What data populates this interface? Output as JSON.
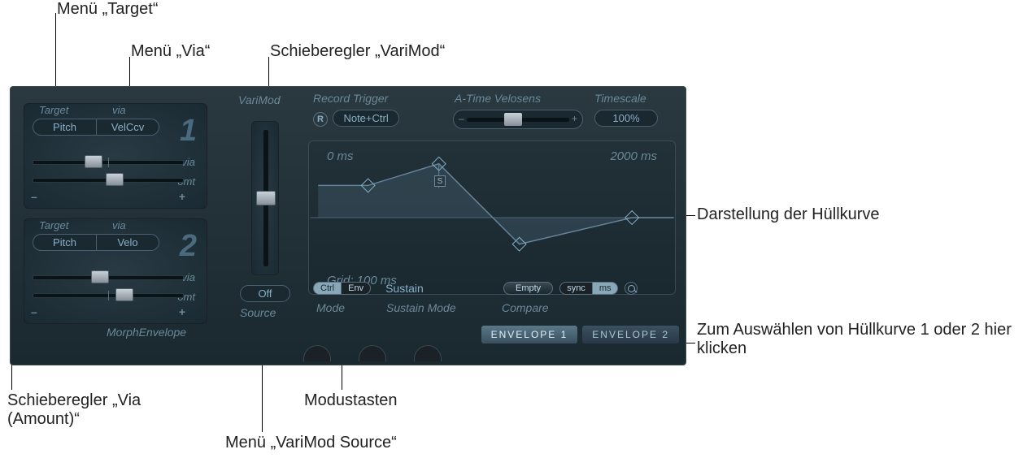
{
  "callouts": {
    "target_menu": "Menü „Target“",
    "via_menu": "Menü „Via“",
    "varimod_slider": "Schieberegler „VariMod“",
    "via_amount_slider": "Schieberegler „Via (Amount)“",
    "varimod_source_menu": "Menü „VariMod Source“",
    "mode_buttons": "Modustasten",
    "envelope_display": "Darstellung der Hüllkurve",
    "envelope_select": "Zum Auswählen von Hüllkurve 1 oder 2 hier klicken"
  },
  "headers": {
    "target": "Target",
    "via": "via",
    "varimod": "VariMod",
    "record_trigger": "Record Trigger",
    "atime": "A-Time Velosens",
    "timescale": "Timescale",
    "source": "Source",
    "mode": "Mode",
    "sustain_mode": "Sustain Mode",
    "compare": "Compare",
    "morph_envelope": "MorphEnvelope"
  },
  "targetvia": [
    {
      "number": "1",
      "target": "Pitch",
      "via": "VelCcv",
      "sub1": "via",
      "sub2": "omt"
    },
    {
      "number": "2",
      "target": "Pitch",
      "via": "Velo",
      "sub1": "via",
      "sub2": "omt"
    }
  ],
  "varimod": {
    "source": "Off"
  },
  "rec_trigger": {
    "r": "R",
    "value": "Note+Ctrl"
  },
  "timescale_value": "100%",
  "envelope": {
    "left_time": "0 ms",
    "right_time": "2000 ms",
    "grid": "Grid: 100 ms",
    "s_marker": "S"
  },
  "bottom_row": {
    "ctrl": "Ctrl",
    "env": "Env",
    "sustain": "Sustain",
    "empty": "Empty",
    "sync": "sync",
    "ms": "ms"
  },
  "tabs": {
    "env1": "ENVELOPE 1",
    "env2": "ENVELOPE 2"
  },
  "signs": {
    "minus": "–",
    "plus": "+"
  }
}
